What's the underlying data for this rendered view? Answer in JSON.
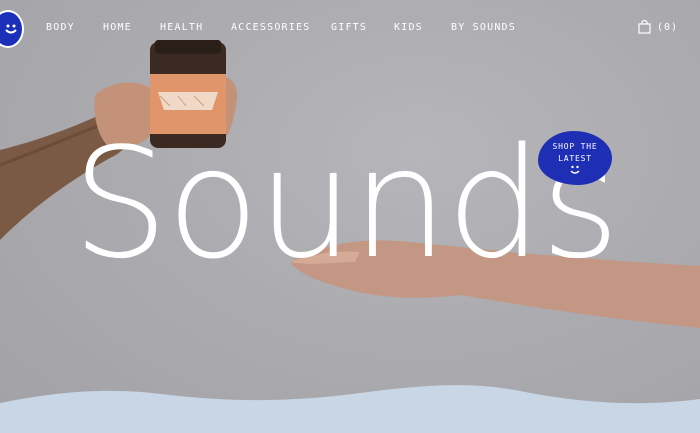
{
  "brand": {
    "logo_icon": "smiley-face-icon",
    "color": "#1e2fb5"
  },
  "nav": {
    "items": [
      {
        "label": "BODY"
      },
      {
        "label": "HOME"
      },
      {
        "label": "HEALTH"
      },
      {
        "label": "ACCESSORIES"
      },
      {
        "label": "GIFTS"
      },
      {
        "label": "KIDS"
      },
      {
        "label": "BY SOUNDS"
      }
    ],
    "cart_label": "(0)",
    "cart_icon": "shopping-bag-icon"
  },
  "hero": {
    "headline": "Sounds",
    "cta_line1": "SHOP THE",
    "cta_line2": "LATEST"
  },
  "colors": {
    "background": "#acacb0",
    "accent": "#1e2fb5",
    "wave": "#c9d6e6"
  }
}
